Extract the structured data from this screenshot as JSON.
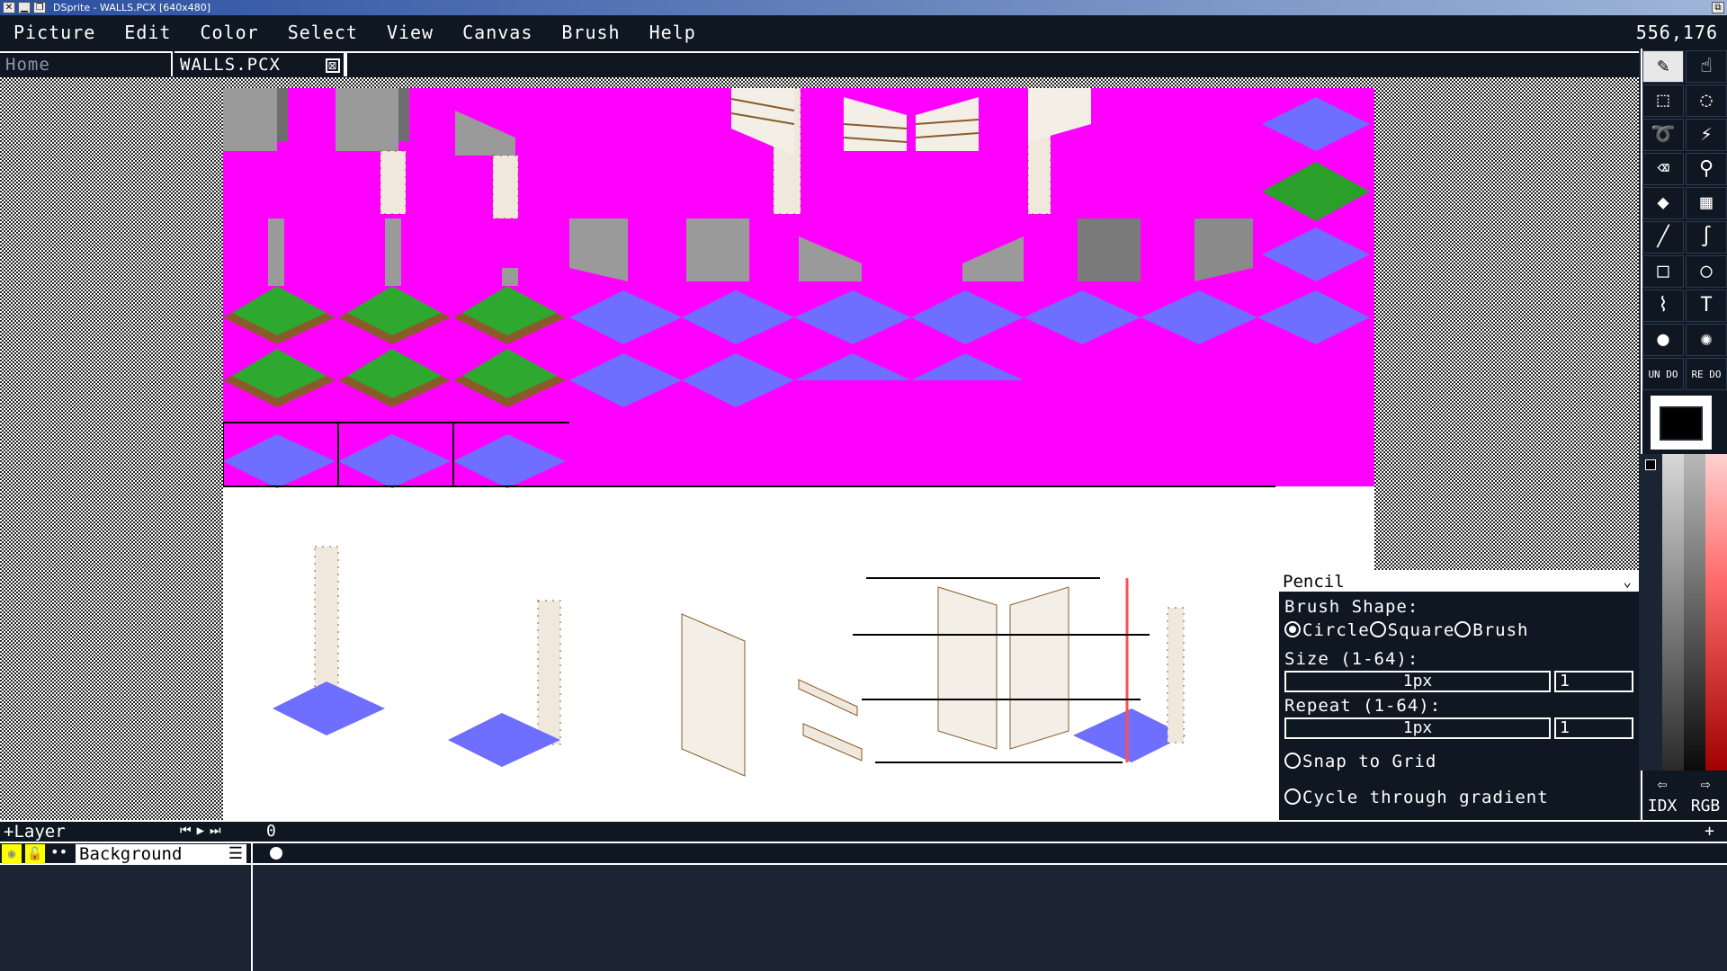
{
  "window": {
    "title": "DSprite - WALLS.PCX [640x480]",
    "buttons": [
      "✕",
      "▁",
      "❐"
    ],
    "right_button": "⧉"
  },
  "menu": [
    "Picture",
    "Edit",
    "Color",
    "Select",
    "View",
    "Canvas",
    "Brush",
    "Help"
  ],
  "coords": "556,176",
  "tabs": {
    "home": "Home",
    "active": "WALLS.PCX",
    "close": "⊠"
  },
  "toolbar": {
    "undo": "UN DO",
    "redo": "RE DO",
    "tools": [
      {
        "name": "pencil-icon",
        "glyph": "✎"
      },
      {
        "name": "hand-icon",
        "glyph": "☝"
      },
      {
        "name": "rect-select-icon",
        "glyph": "⬚"
      },
      {
        "name": "ellipse-select-icon",
        "glyph": "◌"
      },
      {
        "name": "lasso-icon",
        "glyph": "➰"
      },
      {
        "name": "magic-wand-icon",
        "glyph": "⚡"
      },
      {
        "name": "eraser-icon",
        "glyph": "⌫"
      },
      {
        "name": "eyedropper-icon",
        "glyph": "⚲"
      },
      {
        "name": "fill-icon",
        "glyph": "◆"
      },
      {
        "name": "dither-icon",
        "glyph": "▦"
      },
      {
        "name": "line-icon",
        "glyph": "╱"
      },
      {
        "name": "curve-icon",
        "glyph": "∫"
      },
      {
        "name": "rectangle-icon",
        "glyph": "□"
      },
      {
        "name": "ellipse-icon",
        "glyph": "○"
      },
      {
        "name": "smudge-icon",
        "glyph": "⌇"
      },
      {
        "name": "text-icon",
        "glyph": "T"
      },
      {
        "name": "airbrush-icon",
        "glyph": "●"
      },
      {
        "name": "spray-icon",
        "glyph": "✺"
      }
    ]
  },
  "palette": {
    "mode_idx": "IDX",
    "mode_rgb": "RGB",
    "prev": "⇦",
    "next": "⇨",
    "fg_color": "#000000"
  },
  "options": {
    "title": "Pencil",
    "chevron": "⌄",
    "brush_shape_label": "Brush Shape:",
    "shape_circle": "Circle",
    "shape_square": "Square",
    "shape_brush": "Brush",
    "size_label": "Size (1-64):",
    "size_slider": "1px",
    "size_value": "1",
    "repeat_label": "Repeat (1-64):",
    "repeat_slider": "1px",
    "repeat_value": "1",
    "snap_label": "Snap to Grid",
    "cycle_label": "Cycle through gradient"
  },
  "timeline": {
    "add_layer": "+Layer",
    "nav": "⏮▶⏭",
    "frame_number": "0",
    "add": "+",
    "layer_name": "Background",
    "layer_menu": "☰",
    "eye": "◉",
    "lock": "🔓",
    "continuous": "••"
  }
}
